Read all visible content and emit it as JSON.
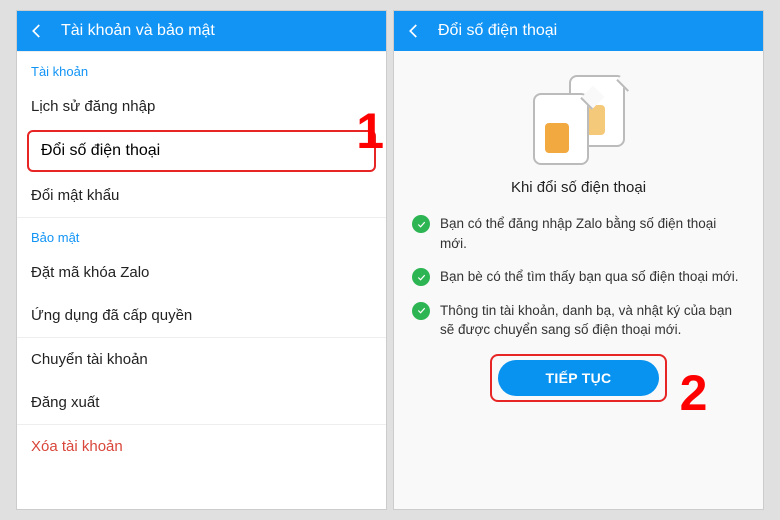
{
  "left": {
    "header_title": "Tài khoản và bảo mật",
    "section_account": "Tài khoản",
    "items_account": [
      "Lịch sử đăng nhập",
      "Đổi số điện thoại",
      "Đổi mật khẩu"
    ],
    "section_security": "Bảo mật",
    "items_security": [
      "Đặt mã khóa Zalo",
      "Ứng dụng đã cấp quyền"
    ],
    "items_other": [
      "Chuyển tài khoản",
      "Đăng xuất"
    ],
    "item_delete": "Xóa tài khoản"
  },
  "right": {
    "header_title": "Đổi số điện thoại",
    "heading": "Khi đổi số điện thoại",
    "bullets": [
      "Bạn có thể đăng nhập Zalo bằng số điện thoại mới.",
      "Bạn bè có thể tìm thấy bạn qua số điện thoại mới.",
      "Thông tin tài khoản, danh bạ, và nhật ký của bạn sẽ được chuyển sang số điện thoại mới."
    ],
    "continue": "TIẾP TỤC"
  },
  "annotations": {
    "one": "1",
    "two": "2"
  }
}
